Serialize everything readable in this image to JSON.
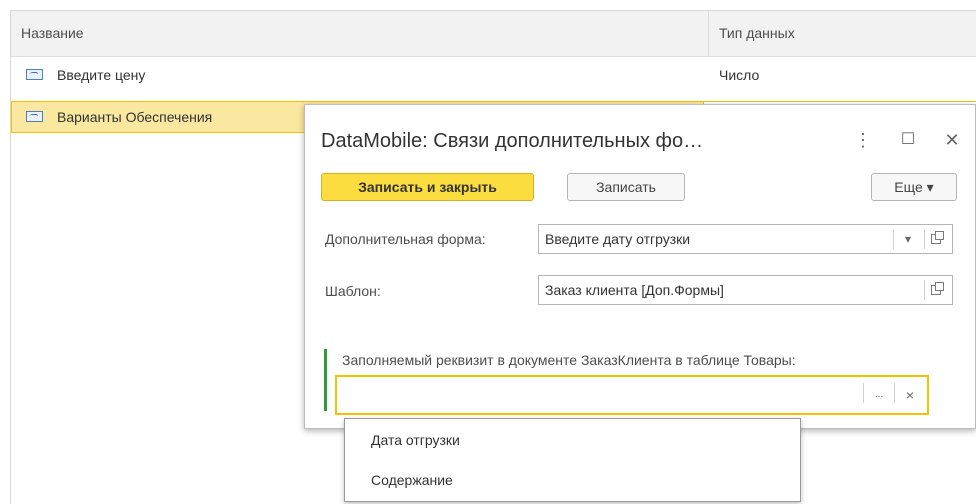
{
  "list": {
    "columns": {
      "name": "Название",
      "type": "Тип данных"
    },
    "rows": [
      {
        "name": "Введите цену",
        "type": "Число",
        "icon": "field-icon"
      },
      {
        "name": "Варианты Обеспечения",
        "type": "",
        "icon": "field-icon",
        "selected": true
      }
    ]
  },
  "modal": {
    "title": "DataMobile: Связи дополнительных фо…",
    "title_controls": {
      "more": "⋮",
      "maximize": "☐",
      "close": "✕"
    },
    "toolbar": {
      "save_close_label": "Записать и закрыть",
      "save_label": "Записать",
      "more_label": "Еще ▾"
    },
    "form_field": {
      "label": "Дополнительная форма:",
      "value": "Введите дату отгрузки"
    },
    "template_field": {
      "label": "Шаблон:",
      "value": "Заказ клиента [Доп.Формы]"
    },
    "requisite_field": {
      "label": "Заполняемый реквизит в документе ЗаказКлиента в таблице Товары:",
      "value": ""
    },
    "icons": {
      "dropdown": "▾",
      "select": "...",
      "clear": "×"
    }
  },
  "dropdown": {
    "options": [
      "Дата отгрузки",
      "Содержание"
    ]
  },
  "colors": {
    "accent_yellow": "#fbdd3f",
    "selection_fill": "#fae8a0",
    "focus_border": "#f2c300",
    "required_mark": "#2e9b3d"
  }
}
